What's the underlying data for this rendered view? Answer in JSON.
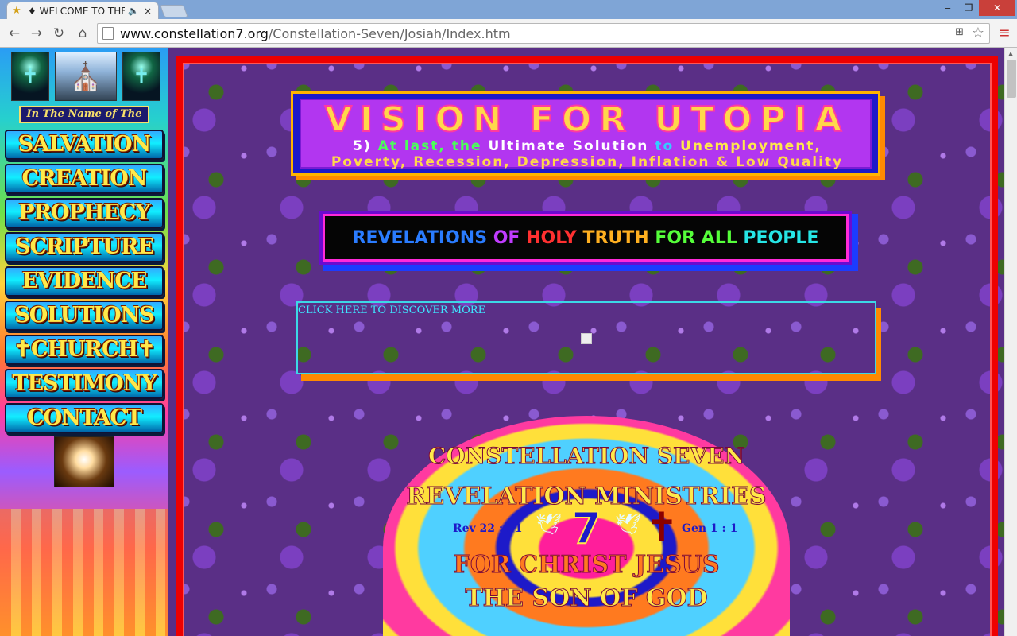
{
  "browser": {
    "tab_title": "♦ WELCOME TO THE",
    "tab_close": "×",
    "url_domain": "www.constellation7.org",
    "url_path": "/Constellation-Seven/Josiah/Index.htm",
    "window_controls": {
      "minimize": "‒",
      "maximize": "❐",
      "close": "✕"
    }
  },
  "sidebar": {
    "banner": "In The Name of The",
    "menu": [
      "SALVATION",
      "CREATION",
      "PROPHECY",
      "SCRIPTURE",
      "EVIDENCE",
      "SOLUTIONS",
      "✝CHURCH✝",
      "TESTIMONY",
      "CONTACT"
    ]
  },
  "main": {
    "vision_title": "VISION FOR UTOPIA",
    "vision_sub1_a": "5)",
    "vision_sub1_b": "At last, the",
    "vision_sub1_c": "Ultimate Solution",
    "vision_sub1_d": "to",
    "vision_sub1_e": "Unemployment,",
    "vision_sub2": "Poverty, Recession, Depression, Inflation & Low Quality",
    "revelations_words": [
      "REVELATIONS",
      "OF",
      "HOLY",
      "TRUTH",
      "FOR ALL",
      "PEOPLE"
    ],
    "click_text": "CLICK HERE TO DISCOVER MORE"
  },
  "logo": {
    "line1": "CONSTELLATION SEVEN",
    "line2": "REVELATION MINISTRIES",
    "ref_left": "Rev 22 : 21",
    "number": "7",
    "ref_right": "Gen 1 : 1",
    "line3": "FOR CHRIST JESUS",
    "line4": "THE SON OF GOD"
  },
  "colors": {
    "frame_red": "#ee0000",
    "accent_yellow": "#ffe94a",
    "link_cyan": "#3ee6ff",
    "bg_purple": "#5a2f86"
  }
}
